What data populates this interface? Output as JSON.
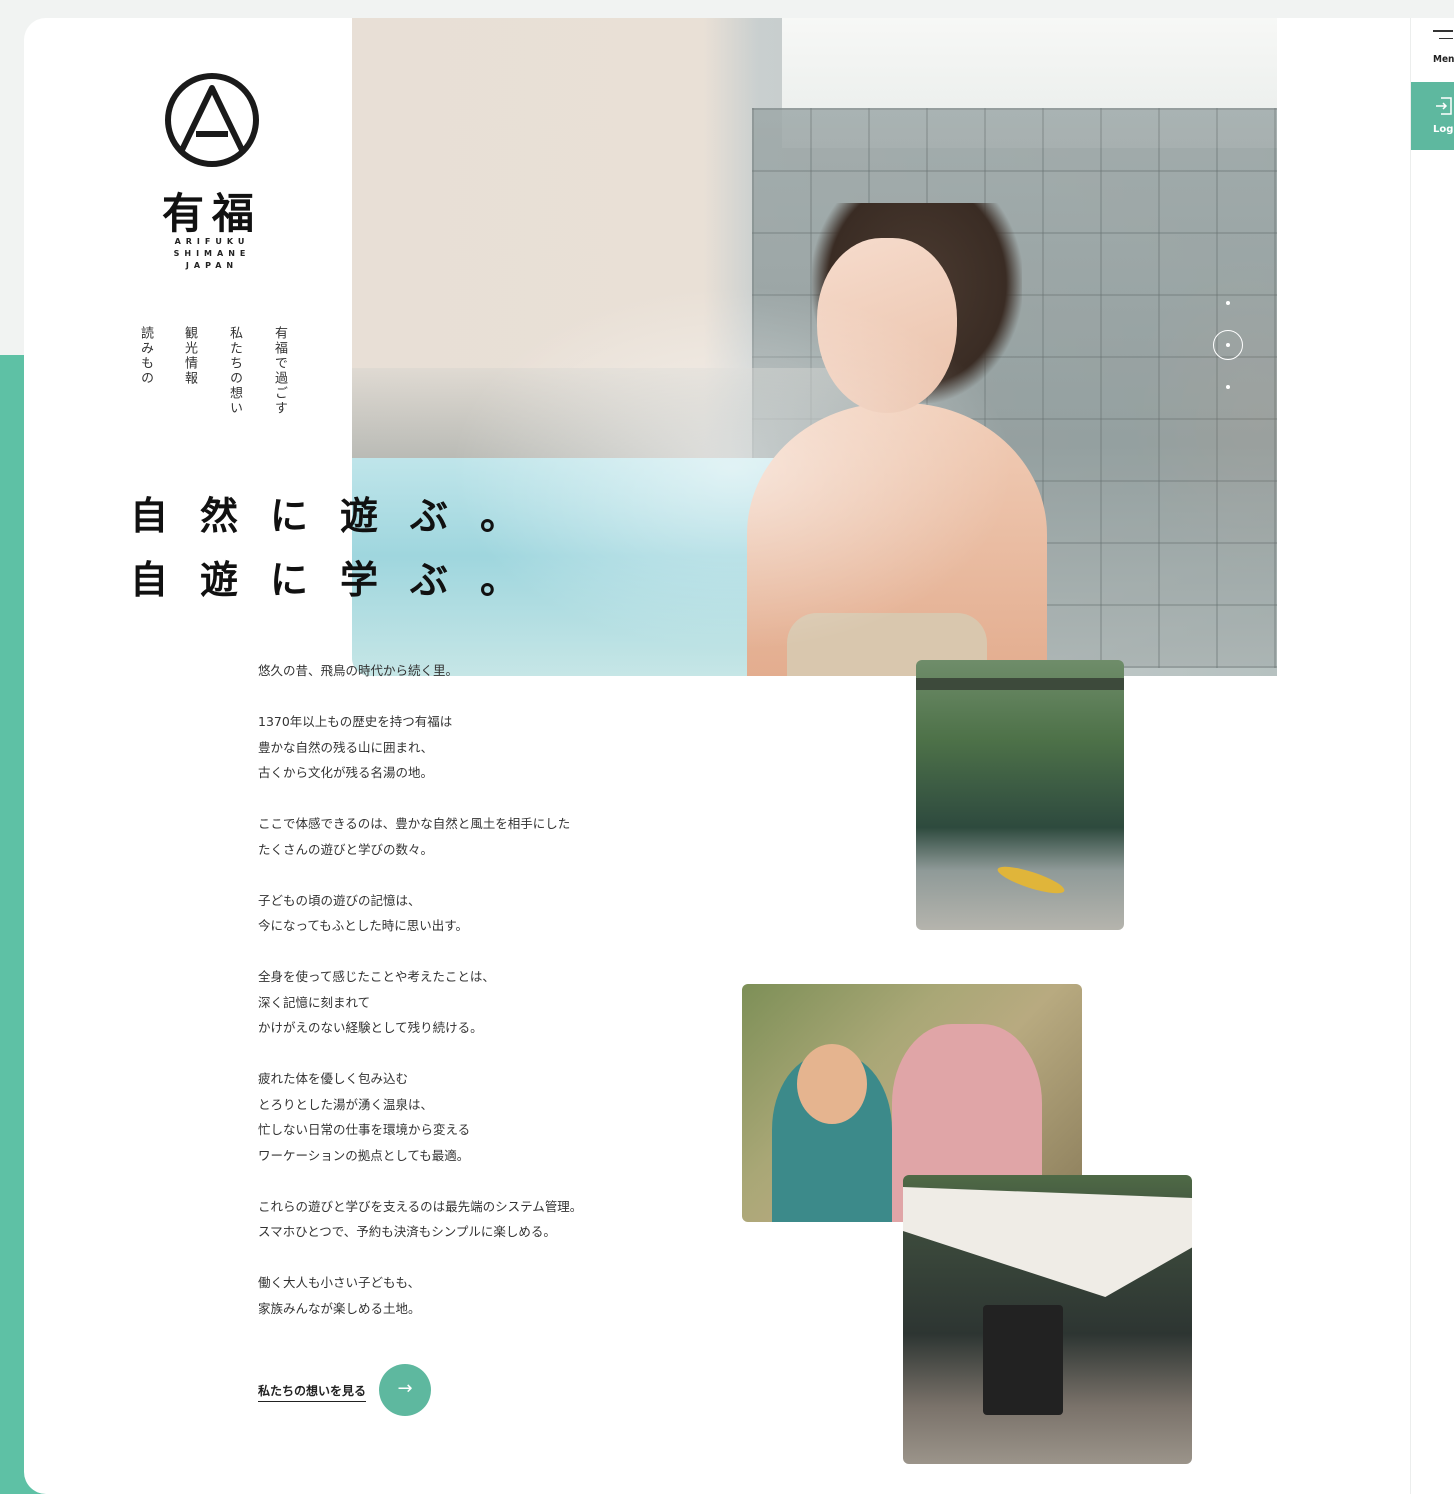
{
  "logo": {
    "kanji": "有福",
    "subtitle_lines": [
      "ARIFUKU",
      "SHIMANE",
      "JAPAN"
    ]
  },
  "nav": {
    "items": [
      {
        "label": "有福で過ごす"
      },
      {
        "label": "私たちの想い"
      },
      {
        "label": "観光情報"
      },
      {
        "label": "読みもの"
      }
    ]
  },
  "rail": {
    "menu_label": "Menu",
    "menu_icon": "hamburger-icon",
    "login_label": "Login",
    "login_icon": "login-arrow-icon"
  },
  "hero": {
    "headline_line1": "自然に遊ぶ。",
    "headline_line2": "自遊に学ぶ。",
    "slider_count": 3,
    "slider_active_index": 1
  },
  "body": {
    "paragraphs": [
      "悠久の昔、飛鳥の時代から続く里。",
      "1370年以上もの歴史を持つ有福は\n豊かな自然の残る山に囲まれ、\n古くから文化が残る名湯の地。",
      "ここで体感できるのは、豊かな自然と風土を相手にした\nたくさんの遊びと学びの数々。",
      "子どもの頃の遊びの記憶は、\n今になってもふとした時に思い出す。",
      "全身を使って感じたことや考えたことは、\n深く記憶に刻まれて\nかけがえのない経験として残り続ける。",
      "疲れた体を優しく包み込む\nとろりとした湯が湧く温泉は、\n忙しない日常の仕事を環境から変える\nワーケーションの拠点としても最適。",
      "これらの遊びと学びを支えるのは最先端のシステム管理。\nスマホひとつで、予約も決済もシンプルに楽しめる。",
      "働く大人も小さい子どもも、\n家族みんなが楽しめる土地。"
    ]
  },
  "cta": {
    "label": "私たちの想いを見る",
    "icon": "arrow-right-icon"
  },
  "colors": {
    "accent": "#5eb89f",
    "strip": "#5ec1a5",
    "text": "#222222"
  }
}
